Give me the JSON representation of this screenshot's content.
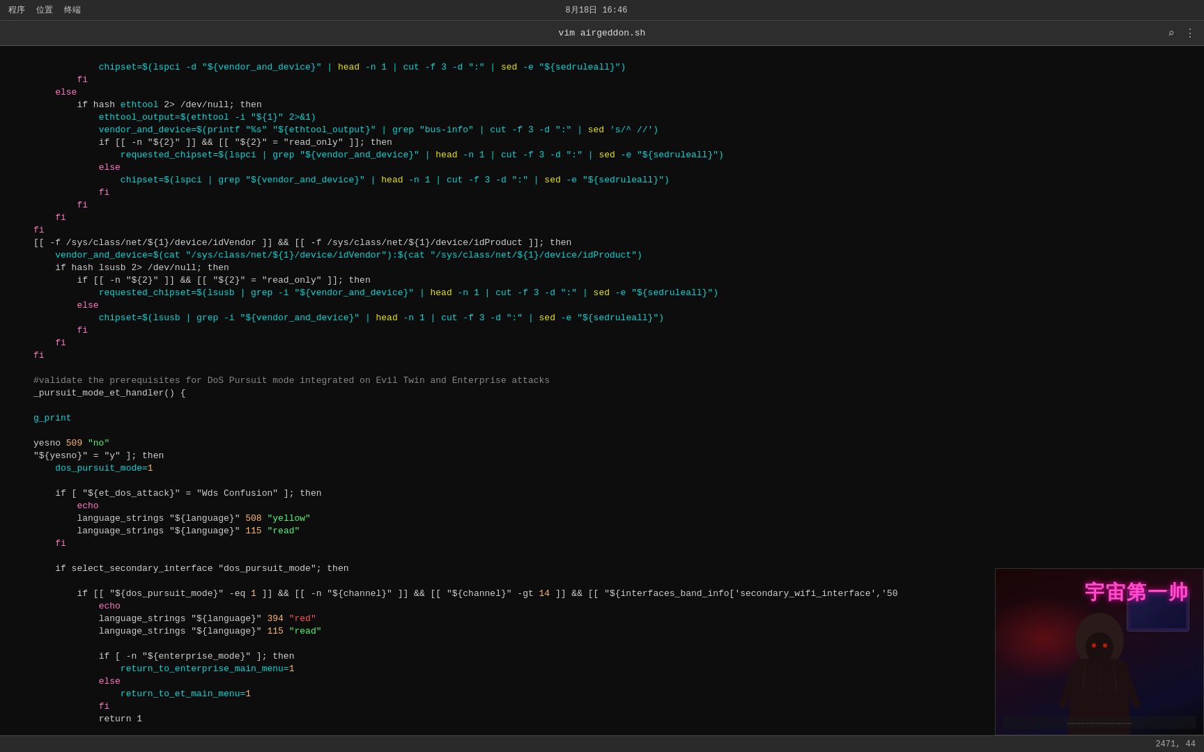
{
  "topbar": {
    "menu_items": [
      "程序",
      "位置",
      "终端"
    ],
    "datetime": "8月18日 16:46"
  },
  "titlebar": {
    "title": "vim airgeddon.sh",
    "search_icon": "⌕",
    "menu_icon": "⋮"
  },
  "statusbar": {
    "position": "2471, 44"
  },
  "overlay": {
    "channel_title": "宇宙第一帅"
  },
  "code": {
    "lines": [
      {
        "num": "",
        "text": ""
      },
      {
        "num": "",
        "indent": "            ",
        "parts": [
          {
            "t": "chipset=$(lspci -d \"${vendor_and_device}\" | ",
            "c": "c-cyan"
          },
          {
            "t": "head",
            "c": "c-yellow"
          },
          {
            "t": " -n 1 | cut -f 3 -d \":\" | ",
            "c": "c-cyan"
          },
          {
            "t": "sed",
            "c": "c-yellow"
          },
          {
            "t": " -e \"${sedruleall}\")",
            "c": "c-cyan"
          }
        ]
      },
      {
        "num": "",
        "indent": "        ",
        "parts": [
          {
            "t": "fi",
            "c": "c-pink"
          }
        ]
      },
      {
        "num": "",
        "indent": "    ",
        "parts": [
          {
            "t": "else",
            "c": "c-pink"
          }
        ]
      },
      {
        "num": "",
        "indent": "        ",
        "parts": [
          {
            "t": "if hash ",
            "c": "c-white"
          },
          {
            "t": "ethtool",
            "c": "c-cyan"
          },
          {
            "t": " 2> /dev/null; then",
            "c": "c-white"
          }
        ]
      },
      {
        "num": "",
        "indent": "            ",
        "parts": [
          {
            "t": "ethtool_output=$(ethtool -i \"${1}\" 2>&1)",
            "c": "c-cyan"
          }
        ]
      },
      {
        "num": "",
        "indent": "            ",
        "parts": [
          {
            "t": "vendor_and_device=$(printf \"%s\" \"${ethtool_output}\" | grep \"bus-info\" | cut -f 3 -d \":\" | ",
            "c": "c-cyan"
          },
          {
            "t": "sed",
            "c": "c-yellow"
          },
          {
            "t": " 's/^ //')",
            "c": "c-cyan"
          }
        ]
      },
      {
        "num": "",
        "indent": "            ",
        "parts": [
          {
            "t": "if [[ -n \"${2}\" ]] && [[ \"${2}\" = \"read_only\" ]]; then",
            "c": "c-white"
          }
        ]
      },
      {
        "num": "",
        "indent": "                ",
        "parts": [
          {
            "t": "requested_chipset=$(lspci | grep \"${vendor_and_device}\" | ",
            "c": "c-cyan"
          },
          {
            "t": "head",
            "c": "c-yellow"
          },
          {
            "t": " -n 1 | cut -f 3 -d \":\" | ",
            "c": "c-cyan"
          },
          {
            "t": "sed",
            "c": "c-yellow"
          },
          {
            "t": " -e \"${sedruleall}\")",
            "c": "c-cyan"
          }
        ]
      },
      {
        "num": "",
        "indent": "            ",
        "parts": [
          {
            "t": "else",
            "c": "c-pink"
          }
        ]
      },
      {
        "num": "",
        "indent": "                ",
        "parts": [
          {
            "t": "chipset=$(lspci | grep \"${vendor_and_device}\" | ",
            "c": "c-cyan"
          },
          {
            "t": "head",
            "c": "c-yellow"
          },
          {
            "t": " -n 1 | cut -f 3 -d \":\" | ",
            "c": "c-cyan"
          },
          {
            "t": "sed",
            "c": "c-yellow"
          },
          {
            "t": " -e \"${sedruleall}\")",
            "c": "c-cyan"
          }
        ]
      },
      {
        "num": "",
        "indent": "            ",
        "parts": [
          {
            "t": "fi",
            "c": "c-pink"
          }
        ]
      },
      {
        "num": "",
        "indent": "        ",
        "parts": [
          {
            "t": "fi",
            "c": "c-pink"
          }
        ]
      },
      {
        "num": "",
        "indent": "    ",
        "parts": [
          {
            "t": "fi",
            "c": "c-pink"
          }
        ]
      },
      {
        "num": "",
        "indent": "",
        "parts": [
          {
            "t": "fi",
            "c": "c-pink"
          }
        ]
      },
      {
        "num": "",
        "indent": "",
        "parts": [
          {
            "t": "[[ -f /sys/class/net/${1}/device/idVendor ]] && [[ -f /sys/class/net/${1}/device/idProduct ]]; then",
            "c": "c-white"
          }
        ]
      },
      {
        "num": "",
        "indent": "    ",
        "parts": [
          {
            "t": "vendor_and_device=$(cat \"/sys/class/net/${1}/device/idVendor\"):$(cat \"/sys/class/net/${1}/device/idProduct\")",
            "c": "c-cyan"
          }
        ]
      },
      {
        "num": "",
        "indent": "    ",
        "parts": [
          {
            "t": "if hash lsusb 2> /dev/null; then",
            "c": "c-white"
          }
        ]
      },
      {
        "num": "",
        "indent": "        ",
        "parts": [
          {
            "t": "if [[ -n \"${2}\" ]] && [[ \"${2}\" = \"read_only\" ]]; then",
            "c": "c-white"
          }
        ]
      },
      {
        "num": "",
        "indent": "            ",
        "parts": [
          {
            "t": "requested_chipset=$(lsusb | grep -i \"${vendor_and_device}\" | ",
            "c": "c-cyan"
          },
          {
            "t": "head",
            "c": "c-yellow"
          },
          {
            "t": " -n 1 | cut -f 3 -d \":\" | ",
            "c": "c-cyan"
          },
          {
            "t": "sed",
            "c": "c-yellow"
          },
          {
            "t": " -e \"${sedruleall}\")",
            "c": "c-cyan"
          }
        ]
      },
      {
        "num": "",
        "indent": "        ",
        "parts": [
          {
            "t": "else",
            "c": "c-pink"
          }
        ]
      },
      {
        "num": "",
        "indent": "            ",
        "parts": [
          {
            "t": "chipset=$(lsusb | grep -i \"${vendor_and_device}\" | ",
            "c": "c-cyan"
          },
          {
            "t": "head",
            "c": "c-yellow"
          },
          {
            "t": " -n 1 | cut -f 3 -d \":\" | ",
            "c": "c-cyan"
          },
          {
            "t": "sed",
            "c": "c-yellow"
          },
          {
            "t": " -e \"${sedruleall}\")",
            "c": "c-cyan"
          }
        ]
      },
      {
        "num": "",
        "indent": "        ",
        "parts": [
          {
            "t": "fi",
            "c": "c-pink"
          }
        ]
      },
      {
        "num": "",
        "indent": "    ",
        "parts": [
          {
            "t": "fi",
            "c": "c-pink"
          }
        ]
      },
      {
        "num": "",
        "indent": "",
        "parts": [
          {
            "t": "fi",
            "c": "c-pink"
          }
        ]
      },
      {
        "num": "",
        "indent": "",
        "parts": []
      },
      {
        "num": "",
        "indent": "",
        "parts": [],
        "comment": true,
        "comment_text": "#validate the prerequisites for DoS Pursuit mode integrated on Evil Twin and Enterprise attacks"
      },
      {
        "num": "",
        "indent": "",
        "parts": [
          {
            "t": "_pursuit_mode_et_handler() {",
            "c": "c-white"
          }
        ]
      },
      {
        "num": "",
        "indent": "",
        "parts": []
      },
      {
        "num": "",
        "indent": "",
        "parts": [
          {
            "t": "g_print",
            "c": "c-cyan"
          }
        ]
      },
      {
        "num": "",
        "indent": "",
        "parts": []
      },
      {
        "num": "",
        "indent": "",
        "parts": [
          {
            "t": "yesno ",
            "c": "c-white"
          },
          {
            "t": "509",
            "c": "c-orange"
          },
          {
            "t": " \"no\"",
            "c": "c-green"
          }
        ]
      },
      {
        "num": "",
        "indent": "",
        "parts": [
          {
            "t": "\"${yesno}\" = \"y\" ]; then",
            "c": "c-white"
          }
        ]
      },
      {
        "num": "",
        "indent": "    ",
        "parts": [
          {
            "t": "dos_pursuit_mode=",
            "c": "c-cyan"
          },
          {
            "t": "1",
            "c": "c-orange"
          }
        ]
      },
      {
        "num": "",
        "indent": "",
        "parts": []
      },
      {
        "num": "",
        "indent": "    ",
        "parts": [
          {
            "t": "if [ \"${et_dos_attack}\" = \"Wds Confusion\" ]; then",
            "c": "c-white"
          }
        ]
      },
      {
        "num": "",
        "indent": "        ",
        "parts": [
          {
            "t": "echo",
            "c": "c-pink"
          }
        ]
      },
      {
        "num": "",
        "indent": "        ",
        "parts": [
          {
            "t": "language_strings \"${language}\" ",
            "c": "c-white"
          },
          {
            "t": "508",
            "c": "c-orange"
          },
          {
            "t": " \"yellow\"",
            "c": "c-green"
          }
        ]
      },
      {
        "num": "",
        "indent": "        ",
        "parts": [
          {
            "t": "language_strings \"${language}\" ",
            "c": "c-white"
          },
          {
            "t": "115",
            "c": "c-orange"
          },
          {
            "t": " \"read\"",
            "c": "c-green"
          }
        ]
      },
      {
        "num": "",
        "indent": "    ",
        "parts": [
          {
            "t": "fi",
            "c": "c-pink"
          }
        ]
      },
      {
        "num": "",
        "indent": "",
        "parts": []
      },
      {
        "num": "",
        "indent": "    ",
        "parts": [
          {
            "t": "if select_secondary_interface \"dos_pursuit_mode\"; then",
            "c": "c-white"
          }
        ]
      },
      {
        "num": "",
        "indent": "",
        "parts": []
      },
      {
        "num": "",
        "indent": "        ",
        "parts": [
          {
            "t": "if [[ \"${dos_pursuit_mode}\" -eq ",
            "c": "c-white"
          },
          {
            "t": "1",
            "c": "c-orange"
          },
          {
            "t": " ]] && [[ -n \"${channel}\" ]] && [[ \"${channel}\" -gt ",
            "c": "c-white"
          },
          {
            "t": "14",
            "c": "c-orange"
          },
          {
            "t": " ]] && [[ \"${interfaces_band_info['secondary_wifi_interface','50",
            "c": "c-white"
          }
        ]
      },
      {
        "num": "",
        "indent": "            ",
        "parts": [
          {
            "t": "echo",
            "c": "c-pink"
          }
        ]
      },
      {
        "num": "",
        "indent": "            ",
        "parts": [
          {
            "t": "language_strings \"${language}\" ",
            "c": "c-white"
          },
          {
            "t": "394",
            "c": "c-orange"
          },
          {
            "t": " \"red\"",
            "c": "c-red"
          }
        ]
      },
      {
        "num": "",
        "indent": "            ",
        "parts": [
          {
            "t": "language_strings \"${language}\" ",
            "c": "c-white"
          },
          {
            "t": "115",
            "c": "c-orange"
          },
          {
            "t": " \"read\"",
            "c": "c-green"
          }
        ]
      },
      {
        "num": "",
        "indent": "",
        "parts": []
      },
      {
        "num": "",
        "indent": "            ",
        "parts": [
          {
            "t": "if [ -n \"${enterprise_mode}\" ]; then",
            "c": "c-white"
          }
        ]
      },
      {
        "num": "",
        "indent": "                ",
        "parts": [
          {
            "t": "return_to_enterprise_main_menu=",
            "c": "c-cyan"
          },
          {
            "t": "1",
            "c": "c-orange"
          }
        ]
      },
      {
        "num": "",
        "indent": "            ",
        "parts": [
          {
            "t": "else",
            "c": "c-pink"
          }
        ]
      },
      {
        "num": "",
        "indent": "                ",
        "parts": [
          {
            "t": "return_to_et_main_menu=",
            "c": "c-cyan"
          },
          {
            "t": "1",
            "c": "c-orange"
          }
        ]
      },
      {
        "num": "",
        "indent": "            ",
        "parts": [
          {
            "t": "fi",
            "c": "c-pink"
          }
        ]
      },
      {
        "num": "",
        "indent": "            ",
        "parts": [
          {
            "t": "return 1",
            "c": "c-white"
          }
        ]
      }
    ]
  }
}
